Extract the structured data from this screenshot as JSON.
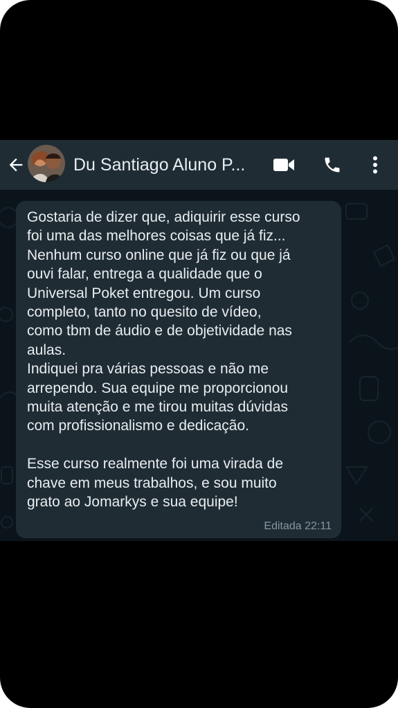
{
  "chat_header": {
    "contact_name": "Du Santiago Aluno P...",
    "back_icon": "arrow-left-icon",
    "video_icon": "video-camera-icon",
    "call_icon": "phone-icon",
    "menu_icon": "more-vertical-icon"
  },
  "message": {
    "text": "Gostaria de dizer que, adiquirir esse curso\nfoi uma das melhores coisas que já fiz...\nNenhum curso online que já fiz ou que já\nouvi falar, entrega a qualidade que o\nUniversal Poket entregou. Um curso\ncompleto, tanto no quesito de vídeo,\ncomo tbm de áudio e de objetividade nas\naulas.\nIndiquei pra várias pessoas e não me\narrependo. Sua equipe me proporcionou\nmuita atenção e me tirou muitas dúvidas\ncom profissionalismo e dedicação.\n\nEsse curso realmente foi uma virada de\nchave em meus trabalhos, e sou muito\ngrato ao Jomarkys e sua equipe!",
    "edited_label": "Editada",
    "time": "22:11"
  },
  "colors": {
    "header_bg": "#1f2c34",
    "chat_bg": "#0b141a",
    "bubble_bg": "#1f2c34",
    "text": "#e9edef",
    "meta": "#8696a0",
    "icon": "#ffffff"
  }
}
